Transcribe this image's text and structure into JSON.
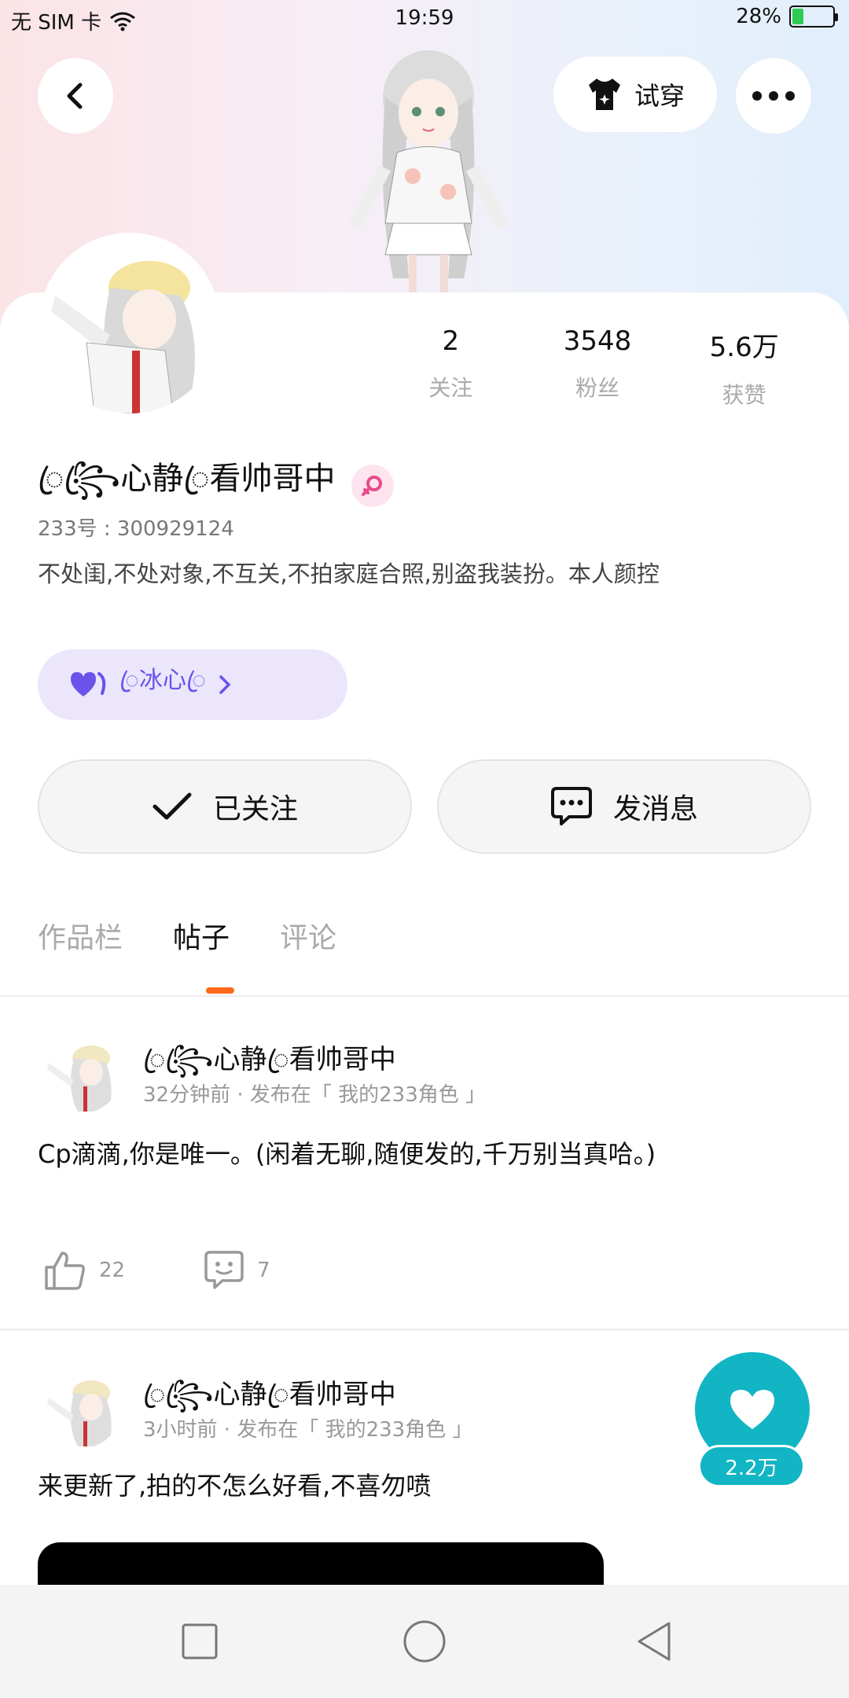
{
  "status_bar": {
    "carrier": "无 SIM 卡",
    "time": "19:59",
    "battery_text": "28%",
    "battery_level": 0.28
  },
  "header": {
    "try_on_label": "试穿"
  },
  "stats": [
    {
      "value": "2",
      "label": "关注"
    },
    {
      "value": "3548",
      "label": "粉丝"
    },
    {
      "value": "5.6万",
      "label": "获赞"
    }
  ],
  "profile": {
    "nickname": "ꦿ꧂ꦿ心静ꦿ看帅哥中",
    "uid": "233号 : 300929124",
    "bio": "不处闺,不处对象,不互关,不拍家庭合照,别盗我装扮。本人颜控",
    "fan_group": "ꦿ冰心ꦿ"
  },
  "actions": {
    "follow_label": "已关注",
    "message_label": "发消息"
  },
  "tabs": [
    {
      "label": "作品栏",
      "active": false
    },
    {
      "label": "帖子",
      "active": true
    },
    {
      "label": "评论",
      "active": false
    }
  ],
  "posts": [
    {
      "author": "ꦿ꧂ꦿ心静ꦿ看帅哥中",
      "meta": "32分钟前 · 发布在「 我的233角色 」",
      "text": "Cp滴滴,你是唯一。(闲着无聊,随便发的,千万别当真哈。)",
      "likes": "22",
      "comments": "7"
    },
    {
      "author": "ꦿ꧂ꦿ心静ꦿ看帅哥中",
      "meta": "3小时前 · 发布在「 我的233角色 」",
      "text": "来更新了,拍的不怎么好看,不喜勿喷"
    }
  ],
  "floating_like": {
    "count": "2.2万"
  },
  "colors": {
    "accent": "#ff6a1a",
    "like": "#12b5c4",
    "fan_pill": "#ebe6fb",
    "fan_text": "#6a52ea"
  }
}
